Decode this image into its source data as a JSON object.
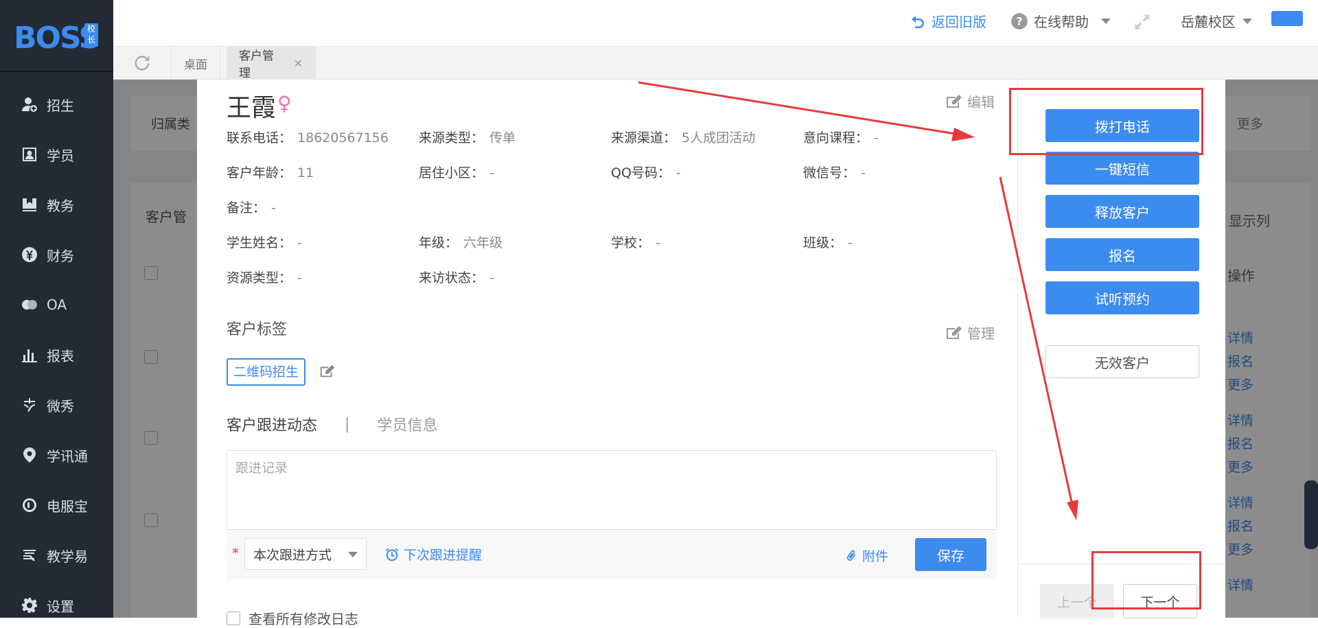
{
  "logo": {
    "text": "BOSS",
    "badge": "校长"
  },
  "sidebar": {
    "items": [
      {
        "label": "招生",
        "icon": "user-plus-icon"
      },
      {
        "label": "学员",
        "icon": "id-card-icon"
      },
      {
        "label": "教务",
        "icon": "book-icon"
      },
      {
        "label": "财务",
        "icon": "yen-icon"
      },
      {
        "label": "OA",
        "icon": "oa-icon"
      },
      {
        "label": "报表",
        "icon": "bar-chart-icon"
      },
      {
        "label": "微秀",
        "icon": "xiu-icon"
      },
      {
        "label": "学讯通",
        "icon": "location-pin-icon"
      },
      {
        "label": "电服宝",
        "icon": "phone-icon"
      },
      {
        "label": "教学易",
        "icon": "teach-icon"
      },
      {
        "label": "设置",
        "icon": "gear-icon"
      }
    ]
  },
  "header": {
    "back": "返回旧版",
    "help": "在线帮助",
    "campus": "岳麓校区"
  },
  "tabs": {
    "desktop": "桌面",
    "customer": "客户管理"
  },
  "background": {
    "filter": "归属类",
    "more": "更多",
    "card_title": "客户管",
    "show_columns": "显示列",
    "action_header": "操作",
    "detail": "详情",
    "signup": "报名",
    "more_link": "更多"
  },
  "customer": {
    "name": "王霞",
    "gender_symbol": "♀",
    "edit": "编辑",
    "fields": {
      "phone_label": "联系电话：",
      "phone": "18620567156",
      "source_type_label": "来源类型：",
      "source_type": "传单",
      "channel_label": "来源渠道：",
      "channel": "5人成团活动",
      "course_label": "意向课程：",
      "course": "-",
      "age_label": "客户年龄：",
      "age": "11",
      "community_label": "居住小区：",
      "community": "-",
      "qq_label": "QQ号码：",
      "qq": "-",
      "wechat_label": "微信号：",
      "wechat": "-",
      "remark_label": "备注：",
      "remark": "-",
      "student_label": "学生姓名：",
      "student": "-",
      "grade_label": "年级：",
      "grade": "六年级",
      "school_label": "学校：",
      "school": "-",
      "class_label": "班级：",
      "class": "-",
      "resource_label": "资源类型：",
      "resource": "-",
      "visit_label": "来访状态：",
      "visit": "-"
    },
    "tags_title": "客户标签",
    "manage": "管理",
    "tag": "二维码招生",
    "tab_follow": "客户跟进动态",
    "tab_sep": "|",
    "tab_student": "学员信息",
    "follow_placeholder": "跟进记录",
    "required": "*",
    "follow_method": "本次跟进方式",
    "remind": "下次跟进提醒",
    "attach": "附件",
    "save": "保存",
    "log": "查看所有修改日志"
  },
  "actions": {
    "call": "拨打电话",
    "sms": "一键短信",
    "release": "释放客户",
    "signup": "报名",
    "trial": "试听预约",
    "invalid": "无效客户",
    "prev": "上一个",
    "next": "下一个"
  },
  "colors": {
    "accent": "#3c8bef",
    "sidebar": "#222b35",
    "annotation": "#e83a3a",
    "female": "#f06ea9"
  }
}
